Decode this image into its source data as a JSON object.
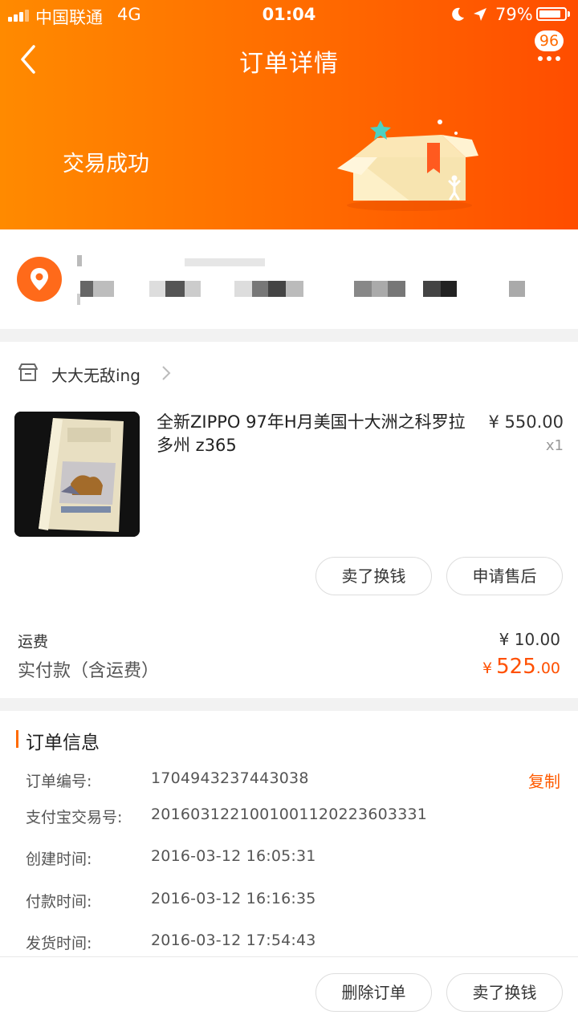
{
  "status_bar": {
    "carrier": "中国联通",
    "network": "4G",
    "time": "01:04",
    "battery": "79%"
  },
  "nav": {
    "title": "订单详情",
    "message_count": "96",
    "back_icon": "chevron-left-icon",
    "more_icon": "more-dots-icon"
  },
  "header": {
    "status": "交易成功",
    "accent_color": "#ff6a00"
  },
  "shop": {
    "name": "大大无敌ing"
  },
  "item": {
    "title": "全新ZIPPO 97年H月美国十大洲之科罗拉多州 z365",
    "price": "¥ 550.00",
    "quantity": "x1"
  },
  "item_actions": {
    "sell": "卖了换钱",
    "after_sale": "申请售后"
  },
  "payment": {
    "shipping_label": "运费",
    "shipping_value": "¥ 10.00",
    "paid_label": "实付款（含运费）",
    "paid_currency": "¥",
    "paid_integer": "525",
    "paid_decimal": ".00"
  },
  "order_info": {
    "title": "订单信息",
    "copy": "复制",
    "rows": [
      {
        "label": "订单编号:",
        "value": "1704943237443038"
      },
      {
        "label": "支付宝交易号:",
        "value": "2016031221001001120223603331"
      },
      {
        "label": "创建时间:",
        "value": "2016-03-12 16:05:31"
      },
      {
        "label": "付款时间:",
        "value": "2016-03-12 16:16:35"
      },
      {
        "label": "发货时间:",
        "value": "2016-03-12 17:54:43"
      }
    ]
  },
  "bottom_bar": {
    "delete": "删除订单",
    "sell": "卖了换钱"
  }
}
